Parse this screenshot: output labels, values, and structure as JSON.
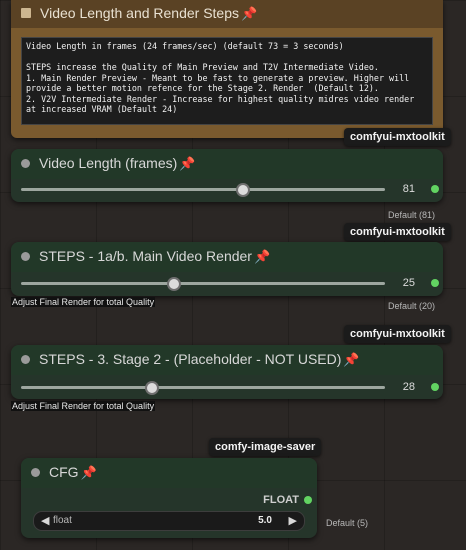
{
  "note": {
    "title": "Video Length and Render Steps",
    "text": "Video Length in frames (24 frames/sec) (default 73 = 3 seconds)\n\nSTEPS increase the Quality of Main Preview and T2V Intermediate Video.\n1. Main Render Preview - Meant to be fast to generate a preview. Higher will\nprovide a better motion refence for the Stage 2. Render  (Default 12).\n2. V2V Intermediate Render - Increase for highest quality midres video render\nat increased VRAM (Default 24)"
  },
  "nodes": [
    {
      "tag": "comfyui-mxtoolkit",
      "title": "Video Length (frames)",
      "value": "81",
      "default": "Default (81)",
      "sub_label": "",
      "level": 0.61
    },
    {
      "tag": "comfyui-mxtoolkit",
      "title": "STEPS - 1a/b. Main Video Render",
      "value": "25",
      "default": "Default (20)",
      "sub_label": "Adjust Final Render for total Quality",
      "level": 0.42
    },
    {
      "tag": "comfyui-mxtoolkit",
      "title": "STEPS - 3. Stage 2 - (Placeholder - NOT USED)",
      "value": "28",
      "default": "",
      "sub_label": "Adjust Final Render for total Quality",
      "level": 0.36
    }
  ],
  "cfg": {
    "tag": "comfy-image-saver",
    "title": "CFG",
    "output_label": "FLOAT",
    "widget_label": "float",
    "widget_value": "5.0",
    "default": "Default (5)"
  },
  "icons": {
    "pin": "pin-icon",
    "left": "arrow-left-icon",
    "right": "arrow-right-icon"
  },
  "colors": {
    "node_body": "#25352a",
    "node_header": "#223828",
    "note": "#7a5a2e",
    "output_dot": "#62d462"
  }
}
